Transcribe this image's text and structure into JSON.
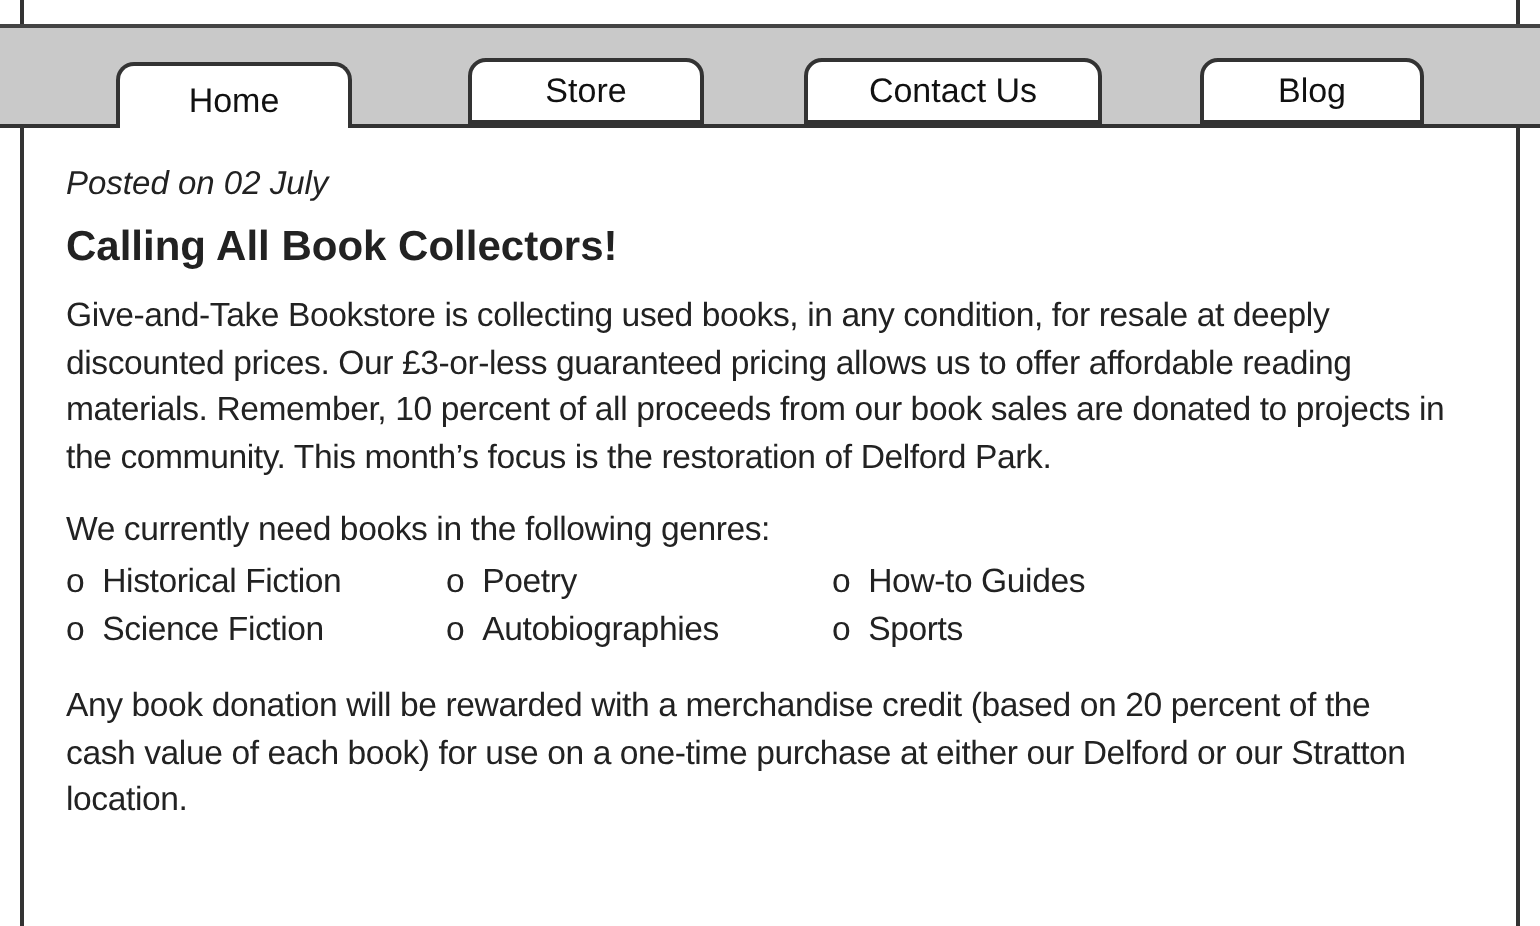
{
  "tabs": [
    {
      "label": "Home",
      "selected": true
    },
    {
      "label": "Store",
      "selected": false
    },
    {
      "label": "Contact Us",
      "selected": false
    },
    {
      "label": "Blog",
      "selected": false
    }
  ],
  "post": {
    "date": "Posted on 02 July",
    "title": "Calling All Book Collectors!",
    "intro": "Give-and-Take Bookstore is collecting used books, in any condition, for resale at deeply discounted prices. Our £3-or-less guaranteed pricing allows us to offer affordable reading materials. Remember, 10 percent of all proceeds from our book sales are donated to projects in the community.  This month’s focus is the restoration of Delford Park.",
    "genres_heading": "We currently need books in the following genres:",
    "genres": [
      {
        "marker": "o",
        "label": "Historical Fiction"
      },
      {
        "marker": "o",
        "label": "Poetry"
      },
      {
        "marker": "o",
        "label": "How-to Guides"
      },
      {
        "marker": "o",
        "label": "Science Fiction"
      },
      {
        "marker": "o",
        "label": "Autobiographies"
      },
      {
        "marker": "o",
        "label": "Sports"
      }
    ],
    "closing": "Any book donation will be rewarded with a merchandise credit (based on 20 percent of the cash value of each book) for use on a one-time purchase at either our Delford or our Stratton location."
  }
}
